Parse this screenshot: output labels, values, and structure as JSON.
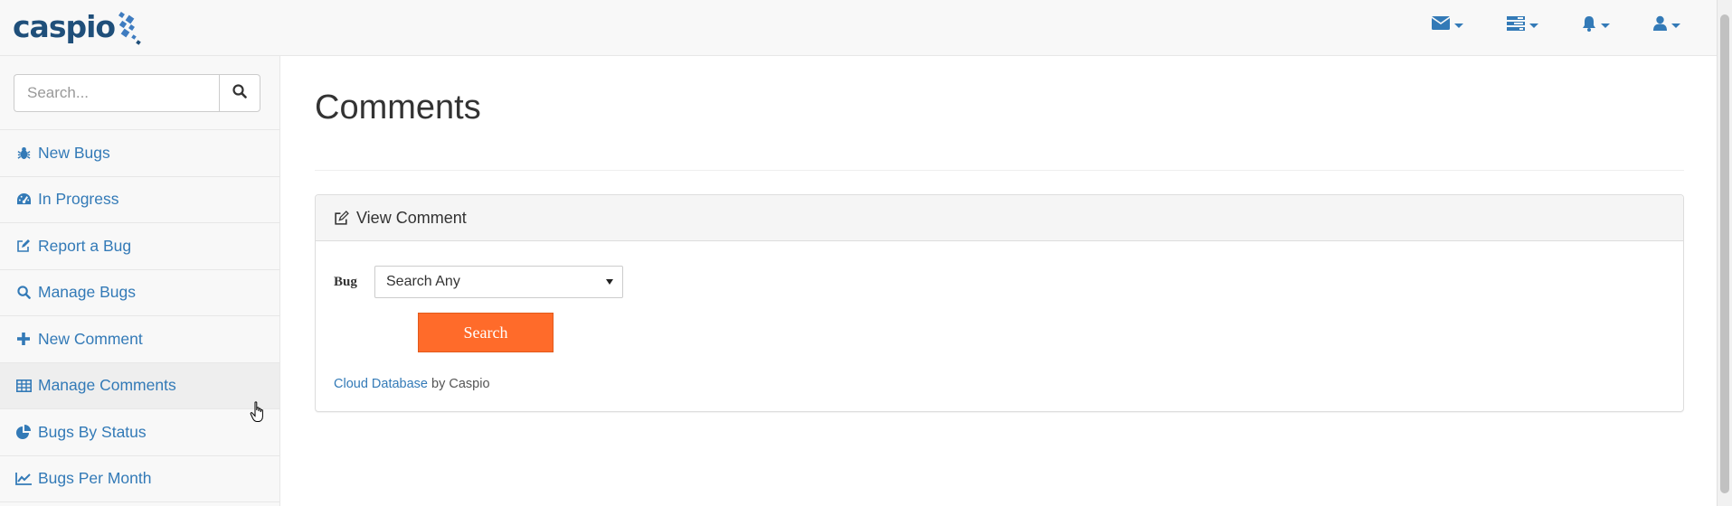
{
  "header": {
    "logo_text": "caspio",
    "icons": [
      {
        "name": "envelope-icon"
      },
      {
        "name": "tasks-icon"
      },
      {
        "name": "bell-icon"
      },
      {
        "name": "user-icon"
      }
    ]
  },
  "sidebar": {
    "search_placeholder": "Search...",
    "items": [
      {
        "label": "New Bugs",
        "icon": "bug-icon"
      },
      {
        "label": "In Progress",
        "icon": "dashboard-icon"
      },
      {
        "label": "Report a Bug",
        "icon": "edit-icon"
      },
      {
        "label": "Manage Bugs",
        "icon": "search-icon"
      },
      {
        "label": "New Comment",
        "icon": "plus-icon"
      },
      {
        "label": "Manage Comments",
        "icon": "table-icon",
        "active": true
      },
      {
        "label": "Bugs By Status",
        "icon": "pie-chart-icon"
      },
      {
        "label": "Bugs Per Month",
        "icon": "line-chart-icon"
      }
    ]
  },
  "main": {
    "title": "Comments",
    "panel": {
      "heading": "View Comment",
      "bug_label": "Bug",
      "bug_select_value": "Search Any",
      "search_button": "Search",
      "footer_link": "Cloud Database",
      "footer_rest": " by Caspio"
    }
  },
  "colors": {
    "link": "#337ab7",
    "accent_button": "#ff6b2a",
    "logo": "#1f4f7a"
  }
}
